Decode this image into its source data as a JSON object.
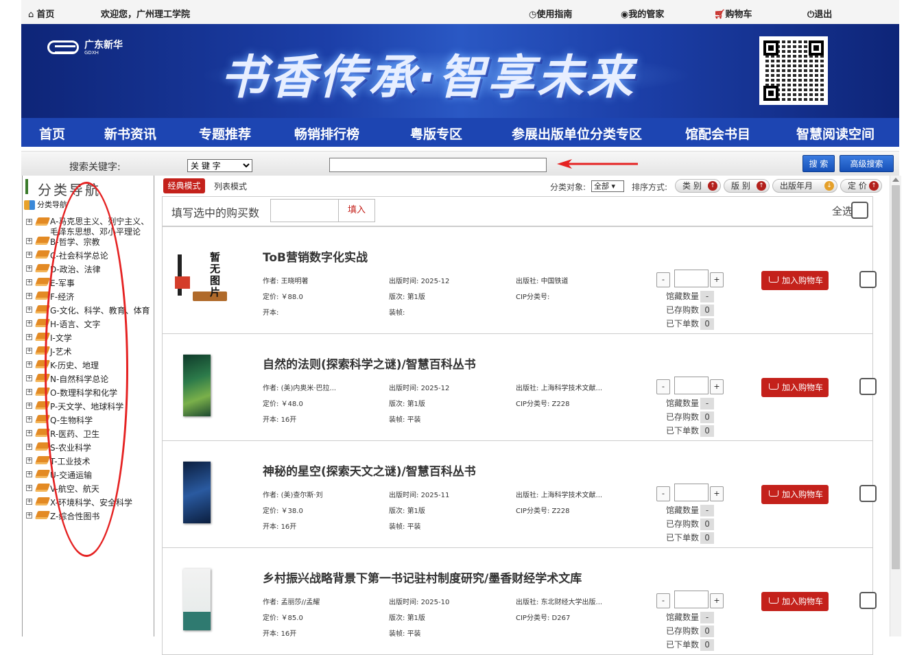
{
  "topbar": {
    "home": "首页",
    "welcome": "欢迎您，广州理工学院",
    "guide": "使用指南",
    "steward": "我的管家",
    "cart": "购物车",
    "logout": "退出"
  },
  "banner": {
    "logo_name": "广东新华",
    "logo_sub": "GDXH",
    "slogan": "书香传承·智享未来"
  },
  "nav": [
    "首页",
    "新书资讯",
    "专题推荐",
    "畅销排行榜",
    "粤版专区",
    "参展出版单位分类专区",
    "馆配会书目",
    "智慧阅读空间"
  ],
  "search": {
    "label": "搜索关键字:",
    "select_value": "关 键 字",
    "search_button": "搜 索",
    "advanced_button": "高级搜索"
  },
  "sidebar": {
    "title": "分类导航",
    "root": "分类导航",
    "categories": [
      "A-马克思主义、列宁主义、毛泽东思想、邓小平理论",
      "B-哲学、宗教",
      "C-社会科学总论",
      "D-政治、法律",
      "E-军事",
      "F-经济",
      "G-文化、科学、教育、体育",
      "H-语言、文字",
      "I-文学",
      "J-艺术",
      "K-历史、地理",
      "N-自然科学总论",
      "O-数理科学和化学",
      "P-天文学、地球科学",
      "Q-生物科学",
      "R-医药、卫生",
      "S-农业科学",
      "T-工业技术",
      "U-交通运输",
      "V-航空、航天",
      "X-环境科学、安全科学",
      "Z-综合性图书"
    ]
  },
  "toolbar": {
    "classic_mode": "经典模式",
    "list_mode": "列表模式",
    "filter_label": "分类对象:",
    "filter_value": "全部",
    "sort_label": "排序方式:",
    "sort_buttons": [
      "类 别",
      "版 别",
      "出版年月",
      "定 价"
    ]
  },
  "fill": {
    "label": "填写选中的购买数",
    "button": "填入",
    "select_all": "全选"
  },
  "labels": {
    "author": "作者:",
    "pubdate": "出版时间:",
    "publisher": "出版社:",
    "price": "定价:",
    "edition": "版次:",
    "cip": "CIP分类号:",
    "format": "开本:",
    "binding": "装帧:",
    "held": "馆藏数量",
    "saved": "已存购数",
    "ordered": "已下单数",
    "add_cart": "加入购物车",
    "no_image": "暂无图片"
  },
  "books": [
    {
      "title": "ToB营销数字化实战",
      "author": "王晓明著",
      "pubdate": "2025-12",
      "publisher": "中国铁道",
      "price": "￥88.0",
      "edition": "第1版",
      "cip": "",
      "format": "",
      "binding": "",
      "held": "-",
      "saved": "0",
      "ordered": "0"
    },
    {
      "title": "自然的法则(探索科学之谜)/智慧百科丛书",
      "author": "(美)内奥米·巴拉...",
      "pubdate": "2025-12",
      "publisher": "上海科学技术文献...",
      "price": "￥48.0",
      "edition": "第1版",
      "cip": "Z228",
      "format": "16开",
      "binding": "平装",
      "held": "-",
      "saved": "0",
      "ordered": "0"
    },
    {
      "title": "神秘的星空(探索天文之谜)/智慧百科丛书",
      "author": "(美)查尔斯·刘",
      "pubdate": "2025-11",
      "publisher": "上海科学技术文献...",
      "price": "￥38.0",
      "edition": "第1版",
      "cip": "Z228",
      "format": "16开",
      "binding": "平装",
      "held": "-",
      "saved": "0",
      "ordered": "0"
    },
    {
      "title": "乡村振兴战略背景下第一书记驻村制度研究/墨香财经学术文库",
      "author": "孟丽莎//孟耀",
      "pubdate": "2025-10",
      "publisher": "东北财经大学出版...",
      "price": "￥85.0",
      "edition": "第1版",
      "cip": "D267",
      "format": "16开",
      "binding": "平装",
      "held": "-",
      "saved": "0",
      "ordered": "0"
    }
  ],
  "colors": {
    "brand_blue": "#1d45b2",
    "accent_red": "#c4211b",
    "annotation_red": "#e52222"
  }
}
